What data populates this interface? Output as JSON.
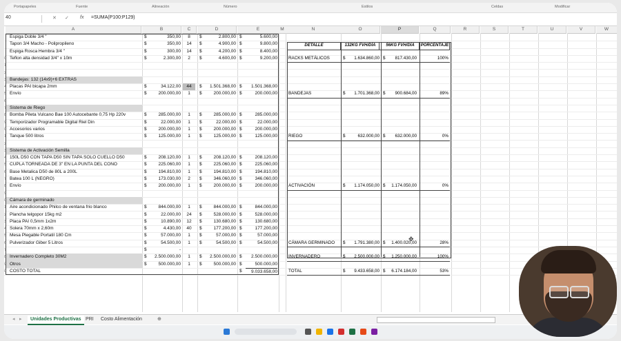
{
  "ribbon": {
    "groups": [
      "Portapapeles",
      "Fuente",
      "Alineación",
      "Número",
      "Estilos",
      "Celdas",
      "Modificar"
    ]
  },
  "formula_bar": {
    "name_box": "40",
    "fx": "fx",
    "formula": "=SUMA(P100:P129)"
  },
  "columns": [
    "A",
    "B",
    "C",
    "D",
    "E",
    "M",
    "N",
    "O",
    "P",
    "Q",
    "R",
    "S",
    "T",
    "U",
    "V",
    "W"
  ],
  "rows": [
    {
      "n": "",
      "a": "Espiga Doble 3/4 \"",
      "b": "350,00",
      "c": "8",
      "d": "2.800,00",
      "e": "5.600,00"
    },
    {
      "n": "",
      "a": "Tapon 3/4 Macho - Polipropileno",
      "b": "350,00",
      "c": "14",
      "d": "4.900,00",
      "e": "9.800,00"
    },
    {
      "n": "",
      "a": "Espiga Rosca Hembra 3/4 \"",
      "b": "300,00",
      "c": "14",
      "d": "4.200,00",
      "e": "8.400,00"
    },
    {
      "n": "0",
      "a": "Teflon alta densidad 3/4\" x 10m",
      "b": "2.300,00",
      "c": "2",
      "d": "4.600,00",
      "e": "9.200,00"
    },
    {
      "n": "1",
      "a": ""
    },
    {
      "n": "2",
      "a": ""
    },
    {
      "n": "3",
      "a": "Bandejas: 132 (14x9)+6 EXTRAS",
      "sec": true
    },
    {
      "n": "4",
      "a": "Placas PAI bicapa 2mm",
      "b": "34.122,00",
      "c": "44",
      "d": "1.501.368,00",
      "e": "1.501.368,00"
    },
    {
      "n": "5",
      "a": "Envío",
      "b": "200.000,00",
      "c": "1",
      "d": "200.000,00",
      "e": "200.000,00"
    },
    {
      "n": "6",
      "a": ""
    },
    {
      "n": "7",
      "a": "Sistema de Riego",
      "sec": true
    },
    {
      "n": "8",
      "a": "Bomba Pileta Vulcano Bae 100 Autocebante 0,75 Hp 220v",
      "b": "285.000,00",
      "c": "1",
      "d": "285.000,00",
      "e": "285.000,00"
    },
    {
      "n": "9",
      "a": "Temporizador Programable Digital Riel Din",
      "b": "22.000,00",
      "c": "1",
      "d": "22.000,00",
      "e": "22.000,00"
    },
    {
      "n": "0",
      "a": "Accesorios varios",
      "b": "200.000,00",
      "c": "1",
      "d": "200.000,00",
      "e": "200.000,00"
    },
    {
      "n": "1",
      "a": "Tanque 500 litros",
      "b": "125.000,00",
      "c": "1",
      "d": "125.000,00",
      "e": "125.000,00"
    },
    {
      "n": "2",
      "a": ""
    },
    {
      "n": "3",
      "a": "Sistema de Activación Semilla",
      "sec": true
    },
    {
      "n": "4",
      "a": "150L D50 CON TAPA D50 SIN TAPA SOLO CUELLO D50",
      "b": "208.120,00",
      "c": "1",
      "d": "208.120,00",
      "e": "208.120,00"
    },
    {
      "n": "5",
      "a": "CUPLA TORNEADA DE 3\" EN LA PUNTA DEL CONO",
      "b": "225.060,00",
      "c": "1",
      "d": "225.060,00",
      "e": "225.060,00"
    },
    {
      "n": "6",
      "a": "Base Metalica D50 de 80L a 200L",
      "b": "194.810,00",
      "c": "1",
      "d": "194.810,00",
      "e": "194.810,00"
    },
    {
      "n": "7",
      "a": "Batea 100 L (NEGRO)",
      "b": "173.030,00",
      "c": "2",
      "d": "346.060,00",
      "e": "346.060,00"
    },
    {
      "n": "8",
      "a": "Envío",
      "b": "200.000,00",
      "c": "1",
      "d": "200.000,00",
      "e": "200.000,00"
    },
    {
      "n": "9",
      "a": ""
    },
    {
      "n": "0",
      "a": "Cámara de germinado",
      "sec": true
    },
    {
      "n": "1",
      "a": "Aire acondicionado Philco de ventana frio blanco",
      "b": "844.000,00",
      "c": "1",
      "d": "844.000,00",
      "e": "844.000,00"
    },
    {
      "n": "2",
      "a": "Plancha telgopor 15kg m2",
      "b": "22.000,00",
      "c": "24",
      "d": "528.000,00",
      "e": "528.000,00"
    },
    {
      "n": "3",
      "a": "Placa PAI 0,5mm 1x2m",
      "b": "10.890,00",
      "c": "12",
      "d": "130.680,00",
      "e": "130.680,00"
    },
    {
      "n": "4",
      "a": "Solera 70mm x 2,60m",
      "b": "4.430,00",
      "c": "40",
      "d": "177.200,00",
      "e": "177.200,00"
    },
    {
      "n": "5",
      "a": "Mesa Plegable Portatil 180 Cm",
      "b": "57.000,00",
      "c": "1",
      "d": "57.000,00",
      "e": "57.000,00"
    },
    {
      "n": "6",
      "a": "Pulverizador Giber 5 Litros",
      "b": "54.500,00",
      "c": "1",
      "d": "54.500,00",
      "e": "54.500,00"
    },
    {
      "n": "7",
      "a": "",
      "b": "-"
    },
    {
      "n": "8",
      "a": "Invernadero Completo 30M2",
      "b": "2.500.000,00",
      "c": "1",
      "d": "2.500.000,00",
      "e": "2.500.000,00",
      "sec": true
    },
    {
      "n": "9",
      "a": "Otros",
      "b": "500.000,00",
      "c": "1",
      "d": "500.000,00",
      "e": "500.000,00",
      "sec": true
    },
    {
      "n": "0",
      "a": "COSTO TOTAL",
      "e": "9.033.658,00"
    }
  ],
  "summary": {
    "headers": [
      "DETALLE",
      "132KG FVH/DÍA",
      "56KG FVH/DÍA",
      "PORCENTAJE"
    ],
    "rows": [
      {
        "label": "RACKS METÁLICOS",
        "o": "1.634.860,00",
        "p": "817.430,00",
        "q": "100%"
      },
      {
        "label": "BANDEJAS",
        "o": "1.701.368,00",
        "p": "900.684,00",
        "q": "89%"
      },
      {
        "label": "RIEGO",
        "o": "632.000,00",
        "p": "632.000,00",
        "q": "0%"
      },
      {
        "label": "ACTIVACIÓN",
        "o": "1.174.050,00",
        "p": "1.174.050,00",
        "q": "0%"
      },
      {
        "label": "CÁMARA GERMINADO",
        "o": "1.791.380,00",
        "p": "1.400.020,00",
        "q": "28%"
      },
      {
        "label": "INVERNADERO",
        "o": "2.500.000,00",
        "p": "1.250.000,00",
        "q": "100%"
      },
      {
        "label": "TOTAL",
        "o": "9.433.658,00",
        "p": "6.174.184,00",
        "q": "53%"
      }
    ]
  },
  "sheet_tabs": [
    "Unidades Productivas",
    "PRI",
    "Costo Alimentación"
  ],
  "currency": "$"
}
